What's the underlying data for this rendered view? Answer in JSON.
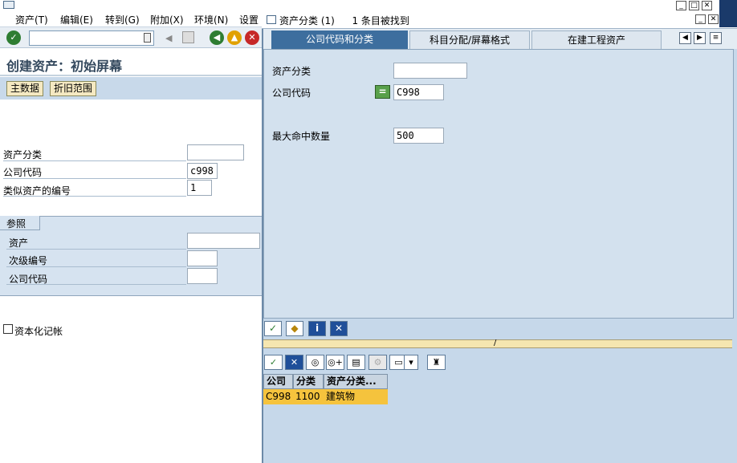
{
  "main": {
    "menu": [
      "资产(T)",
      "编辑(E)",
      "转到(G)",
      "附加(X)",
      "环境(N)",
      "设置"
    ],
    "title": "创建资产：初始屏幕",
    "buttons": {
      "master_data": "主数据",
      "depreciation_area": "折旧范围"
    },
    "fields": {
      "asset_class_label": "资产分类",
      "asset_class_value": "",
      "company_code_label": "公司代码",
      "company_code_value": "c998",
      "similar_assets_label": "类似资产的编号",
      "similar_assets_value": "1"
    },
    "reference": {
      "group_label": "参照",
      "asset_label": "资产",
      "asset_value": "",
      "subnumber_label": "次级编号",
      "subnumber_value": "",
      "company_code_label": "公司代码",
      "company_code_value": ""
    },
    "capitalize_label": "资本化记帐",
    "capitalize_checked": false
  },
  "popup": {
    "title": "资产分类 (1)",
    "status": "1 条目被找到",
    "tabs": [
      "公司代码和分类",
      "科目分配/屏幕格式",
      "在建工程资产"
    ],
    "active_tab": 0,
    "fields": {
      "asset_class_label": "资产分类",
      "asset_class_value": "",
      "company_code_label": "公司代码",
      "company_code_value": "C998",
      "max_hits_label": "最大命中数量",
      "max_hits_value": "500"
    },
    "results": {
      "columns": [
        "公司",
        "分类",
        "资产分类..."
      ],
      "rows": [
        [
          "C998",
          "1100",
          "建筑物"
        ]
      ]
    }
  },
  "colors": {
    "accent": "#3d6e9e",
    "selection": "#f5c33d",
    "panel": "#d3e1ee"
  },
  "icons": {
    "check": "check-icon",
    "cancel": "cancel-icon",
    "info": "info-icon",
    "find": "binoculars-icon",
    "print": "print-icon",
    "settings": "tree-icon"
  }
}
